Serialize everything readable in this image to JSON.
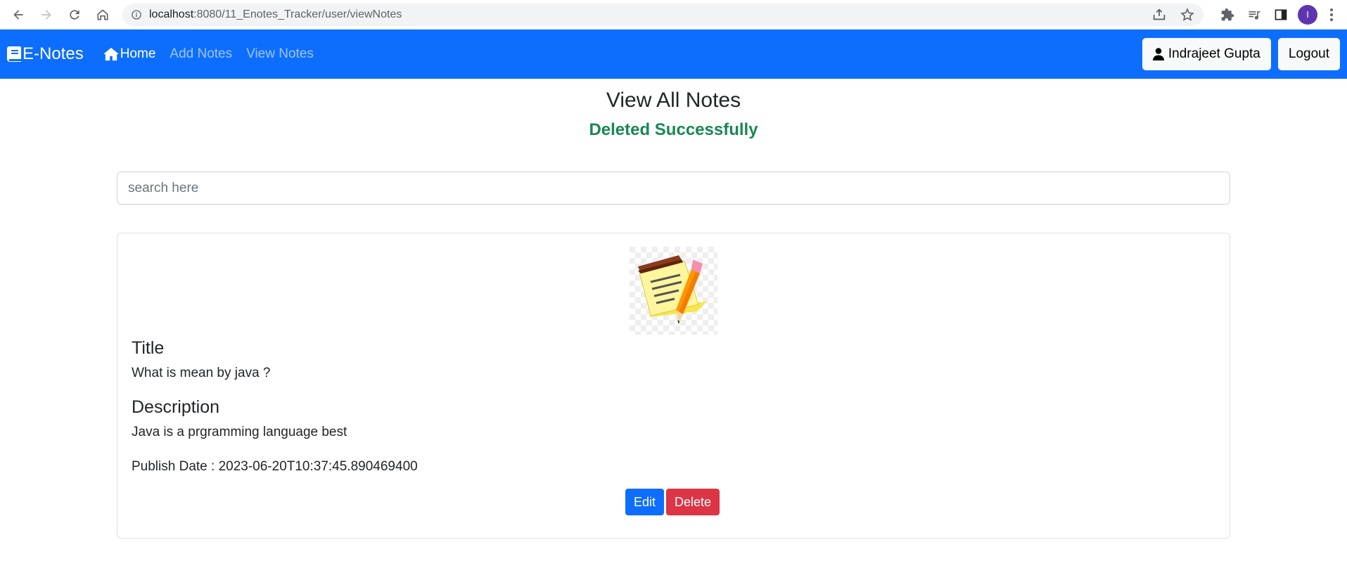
{
  "browser": {
    "url_host": "localhost",
    "url_rest": ":8080/11_Enotes_Tracker/user/viewNotes",
    "profile_initial": "I"
  },
  "navbar": {
    "brand": "E-Notes",
    "home": "Home",
    "add_notes": "Add Notes",
    "view_notes": "View Notes",
    "user_name": "Indrajeet Gupta",
    "logout": "Logout"
  },
  "page": {
    "title": "View All Notes",
    "message": "Deleted Successfully",
    "search_placeholder": "search here"
  },
  "note": {
    "title_heading": "Title",
    "title": "What is mean by java ?",
    "description_heading": "Description",
    "description": "Java is a prgramming language best",
    "publish_date": "Publish Date : 2023-06-20T10:37:45.890469400",
    "edit_label": "Edit",
    "delete_label": "Delete"
  },
  "colors": {
    "primary": "#0d6efd",
    "success": "#198754",
    "danger": "#dc3545"
  }
}
